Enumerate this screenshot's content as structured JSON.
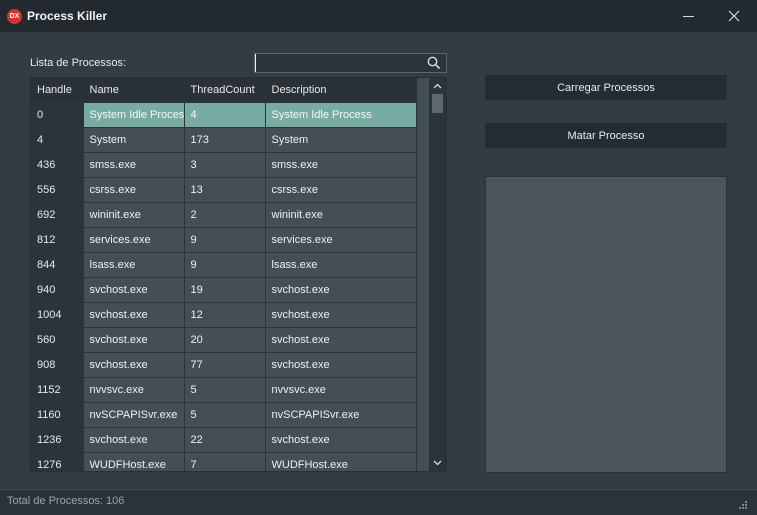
{
  "window": {
    "title": "Process Killer",
    "icon_text": "DX"
  },
  "left": {
    "list_label": "Lista de Processos:",
    "search": {
      "value": "",
      "placeholder": ""
    },
    "columns": [
      "Handle",
      "Name",
      "ThreadCount",
      "Description"
    ],
    "selected_row": 0,
    "rows": [
      [
        "0",
        "System Idle Process",
        "4",
        "System Idle Process"
      ],
      [
        "4",
        "System",
        "173",
        "System"
      ],
      [
        "436",
        "smss.exe",
        "3",
        "smss.exe"
      ],
      [
        "556",
        "csrss.exe",
        "13",
        "csrss.exe"
      ],
      [
        "692",
        "wininit.exe",
        "2",
        "wininit.exe"
      ],
      [
        "812",
        "services.exe",
        "9",
        "services.exe"
      ],
      [
        "844",
        "lsass.exe",
        "9",
        "lsass.exe"
      ],
      [
        "940",
        "svchost.exe",
        "19",
        "svchost.exe"
      ],
      [
        "1004",
        "svchost.exe",
        "12",
        "svchost.exe"
      ],
      [
        "560",
        "svchost.exe",
        "20",
        "svchost.exe"
      ],
      [
        "908",
        "svchost.exe",
        "77",
        "svchost.exe"
      ],
      [
        "1152",
        "nvvsvc.exe",
        "5",
        "nvvsvc.exe"
      ],
      [
        "1160",
        "nvSCPAPISvr.exe",
        "5",
        "nvSCPAPISvr.exe"
      ],
      [
        "1236",
        "svchost.exe",
        "22",
        "svchost.exe"
      ],
      [
        "1276",
        "WUDFHost.exe",
        "7",
        "WUDFHost.exe"
      ]
    ]
  },
  "right": {
    "load_button": "Carregar Processos",
    "kill_button": "Matar Processo"
  },
  "status": {
    "text": "Total de Processos: 106"
  },
  "colors": {
    "background": "#333c43",
    "titlebar": "#222a30",
    "selection": "#78aba1",
    "app_icon": "#d9302b"
  },
  "icons": [
    "app-icon",
    "minimize-icon",
    "close-icon",
    "search-icon",
    "scroll-up-icon",
    "scroll-down-icon",
    "resize-grip-icon"
  ]
}
